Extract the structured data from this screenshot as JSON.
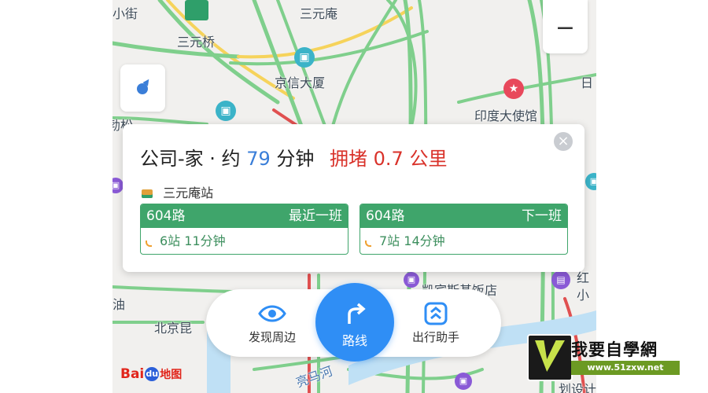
{
  "map": {
    "labels": {
      "sanyuanqiao": "三元桥",
      "sanyuanan": "三元庵",
      "jingxin": "京信大厦",
      "indian_embassy": "印度大使馆",
      "beijing_kun": "北京昆",
      "liangmahe": "亮马河",
      "kempinski": "凯宾斯基饭店",
      "xiaojie": "小街",
      "hong": "红",
      "xiao": "小",
      "you": "油",
      "jinsong": "勃松",
      "ri": "日",
      "hua": "划设计"
    },
    "zoom_out_label": "−"
  },
  "card": {
    "title_prefix": "公司-家 · 约",
    "minutes": "79",
    "minutes_unit": "分钟",
    "jam_text": "拥堵 0.7 公里",
    "close_glyph": "×",
    "stop_name": "三元庵站",
    "buses": [
      {
        "route": "604路",
        "tag": "最近一班",
        "info": "6站 11分钟"
      },
      {
        "route": "604路",
        "tag": "下一班",
        "info": "7站 14分钟"
      }
    ]
  },
  "bottom_bar": {
    "discover_label": "发现周边",
    "route_label": "路线",
    "assistant_label": "出行助手"
  },
  "logo": {
    "bai": "Bai",
    "du": "du",
    "ditu": "地图"
  },
  "watermark": {
    "title": "我要自學網",
    "url": "www.51zxw.net"
  },
  "colors": {
    "accent_blue": "#2f8ef5",
    "bus_green": "#3fa56b",
    "jam_red": "#d9322a",
    "minutes_blue": "#3a7ed8"
  }
}
